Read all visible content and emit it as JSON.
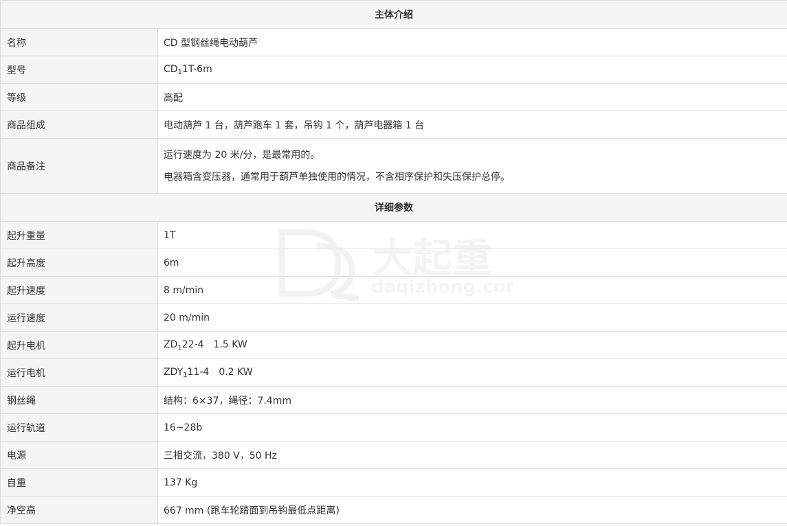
{
  "section1": {
    "title": "主体介绍",
    "rows": [
      {
        "label": "名称",
        "value": "CD 型钢丝绳电动葫芦"
      },
      {
        "label": "型号",
        "value_pre": "CD",
        "value_sub": "1",
        "value_post": "1T-6m"
      },
      {
        "label": "等级",
        "value": "高配"
      },
      {
        "label": "商品组成",
        "value": "电动葫芦 1 台，葫芦跑车 1 套，吊钩 1 个，葫芦电器箱 1 台"
      },
      {
        "label": "商品备注",
        "line1": "运行速度为 20 米/分，是最常用的。",
        "line2": "电器箱含变压器，通常用于葫芦单独使用的情况，不含相序保护和失压保护总停。"
      }
    ]
  },
  "section2": {
    "title": "详细参数",
    "rows": [
      {
        "label": "起升重量",
        "value": "1T"
      },
      {
        "label": "起升高度",
        "value": "6m"
      },
      {
        "label": "起升速度",
        "value": "8 m/min"
      },
      {
        "label": "运行速度",
        "value": "20 m/min"
      },
      {
        "label": "起升电机",
        "value_pre": "ZD",
        "value_sub": "1",
        "value_post": "22-4",
        "value_extra": "1.5 KW"
      },
      {
        "label": "运行电机",
        "value_pre": "ZDY",
        "value_sub": "1",
        "value_post": "11-4",
        "value_extra": "0.2 KW"
      },
      {
        "label": "钢丝绳",
        "value": "结构：6×37，绳径：7.4mm"
      },
      {
        "label": "运行轨道",
        "value": "16~28b"
      },
      {
        "label": "电源",
        "value": "三相交流，380 V，50 Hz"
      },
      {
        "label": "自重",
        "value": "137 Kg"
      },
      {
        "label": "净空高",
        "value": "667 mm (跑车轮踏面到吊钩最低点距离)"
      }
    ]
  },
  "watermark": {
    "brand": "大起重",
    "domain": "daqizhong.com",
    "color": "#e6e6e6"
  }
}
